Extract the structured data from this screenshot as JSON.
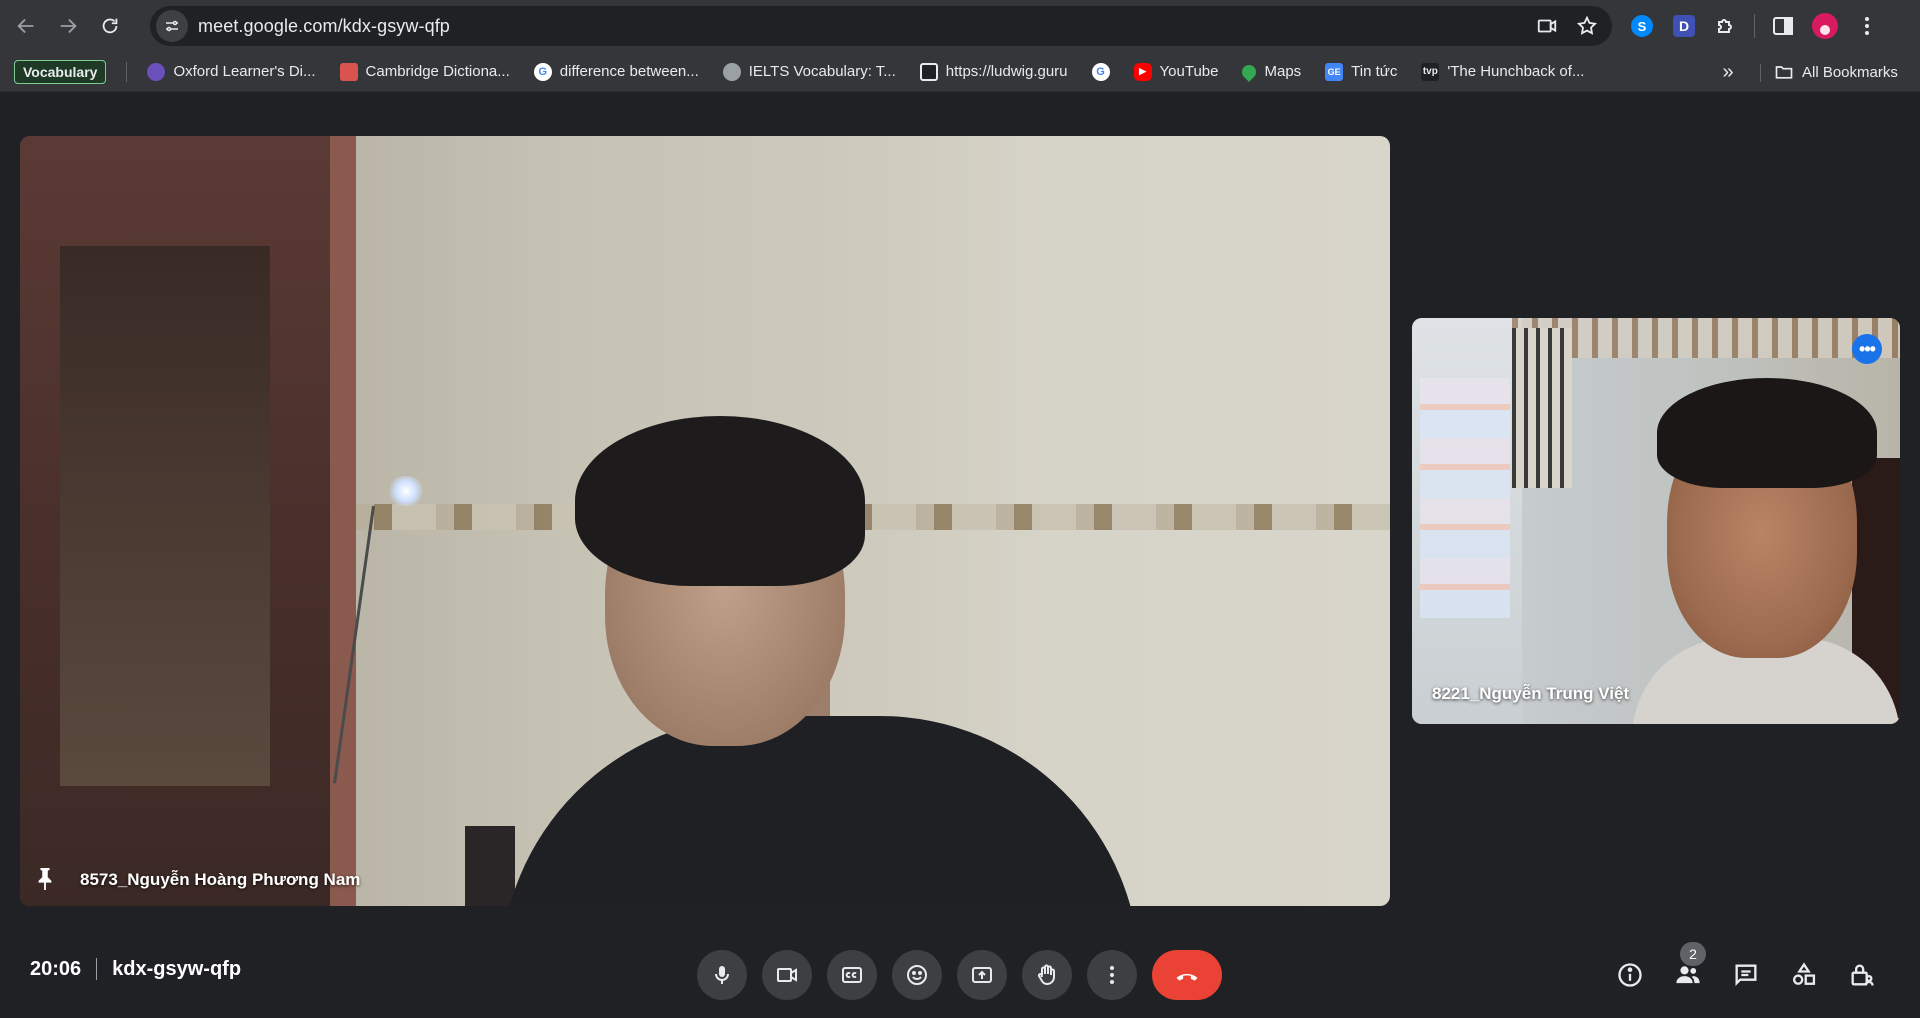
{
  "browser": {
    "url": "meet.google.com/kdx-gsyw-qfp",
    "bookmarks_folder_chip": "Vocabulary",
    "bookmarks": [
      {
        "label": "Oxford Learner's Di...",
        "icon": "oxford-icon",
        "color": "#6b4fbb"
      },
      {
        "label": "Cambridge Dictiona...",
        "icon": "cambridge-icon",
        "color": "#d9534f"
      },
      {
        "label": "difference between...",
        "icon": "google-icon",
        "color": "#ffffff"
      },
      {
        "label": "IELTS Vocabulary: T...",
        "icon": "globe-icon",
        "color": "#9aa0a6"
      },
      {
        "label": "https://ludwig.guru",
        "icon": "ludwig-icon",
        "color": "#202124"
      },
      {
        "label": "",
        "icon": "google-icon",
        "color": "#ffffff"
      },
      {
        "label": "YouTube",
        "icon": "youtube-icon",
        "color": "#ff0000"
      },
      {
        "label": "Maps",
        "icon": "maps-icon",
        "color": "#34a853"
      },
      {
        "label": "Tin tức",
        "icon": "news-icon",
        "color": "#4285f4"
      },
      {
        "label": "'The Hunchback of...",
        "icon": "tvp-icon",
        "color": "#202124"
      }
    ],
    "all_bookmarks_label": "All Bookmarks",
    "extension_d_letter": "D"
  },
  "meet": {
    "participants": {
      "main": {
        "name": "8573_Nguyễn Hoàng Phương Nam",
        "pinned": true
      },
      "side": {
        "name": "8221_Nguyễn Trung Việt"
      }
    },
    "time": "20:06",
    "meeting_code": "kdx-gsyw-qfp",
    "people_count": "2",
    "controls": [
      "microphone",
      "camera",
      "captions",
      "reactions",
      "present",
      "raise-hand",
      "more-options",
      "leave-call"
    ],
    "right_controls": [
      "meeting-details",
      "people",
      "chat",
      "activities",
      "host-controls"
    ],
    "colors": {
      "end_call": "#ea4335",
      "background": "#202124",
      "control": "#3c4043",
      "more_button": "#1a73e8"
    }
  }
}
